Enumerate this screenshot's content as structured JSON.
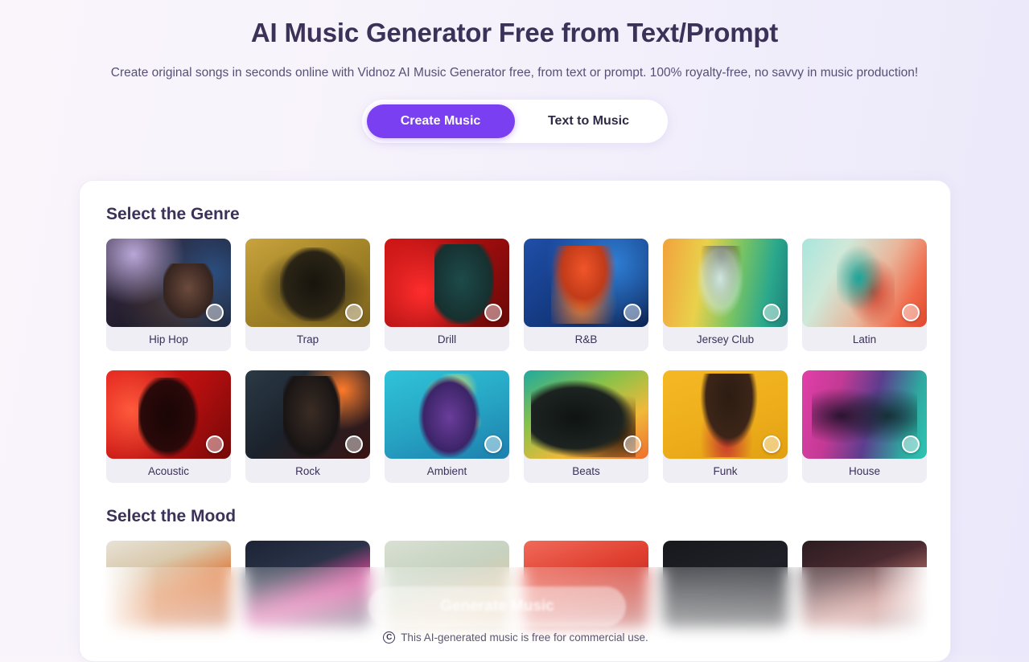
{
  "hero": {
    "title": "AI Music Generator Free from Text/Prompt",
    "subtitle": "Create original songs in seconds online with Vidnoz AI Music Generator free, from text or prompt. 100% royalty-free, no savvy in music production!"
  },
  "mode_toggle": {
    "active": "Create Music",
    "options": [
      {
        "label": "Create Music",
        "active": true
      },
      {
        "label": "Text to Music",
        "active": false
      }
    ]
  },
  "genre_section": {
    "title": "Select the Genre",
    "items": [
      {
        "label": "Hip Hop",
        "art": "art-hiphop",
        "selected": false
      },
      {
        "label": "Trap",
        "art": "art-trap",
        "selected": false
      },
      {
        "label": "Drill",
        "art": "art-drill",
        "selected": false
      },
      {
        "label": "R&B",
        "art": "art-rnb",
        "selected": false
      },
      {
        "label": "Jersey Club",
        "art": "art-jersey",
        "selected": false
      },
      {
        "label": "Latin",
        "art": "art-latin",
        "selected": false
      },
      {
        "label": "Acoustic",
        "art": "art-acoustic",
        "selected": false
      },
      {
        "label": "Rock",
        "art": "art-rock",
        "selected": false
      },
      {
        "label": "Ambient",
        "art": "art-ambient",
        "selected": false
      },
      {
        "label": "Beats",
        "art": "art-beats",
        "selected": false
      },
      {
        "label": "Funk",
        "art": "art-funk",
        "selected": false
      },
      {
        "label": "House",
        "art": "art-house",
        "selected": false
      }
    ]
  },
  "mood_section": {
    "title": "Select the Mood",
    "items": [
      {
        "label": "",
        "art": "art-mood-1"
      },
      {
        "label": "",
        "art": "art-mood-2"
      },
      {
        "label": "",
        "art": "art-mood-3"
      },
      {
        "label": "",
        "art": "art-mood-4"
      },
      {
        "label": "",
        "art": "art-mood-5"
      },
      {
        "label": "",
        "art": "art-mood-6"
      }
    ]
  },
  "footer": {
    "generate_label": "Generate Music",
    "license_icon": "copyright-icon",
    "license_text": "This AI-generated music is free for commercial use."
  },
  "colors": {
    "accent_purple": "#7b3ff2",
    "heading": "#3b3159",
    "body_text": "#565076",
    "card_label_bg": "#eeeef4",
    "panel_bg": "#ffffff",
    "page_bg_start": "#faf5fb",
    "page_bg_end": "#eae8fa"
  }
}
